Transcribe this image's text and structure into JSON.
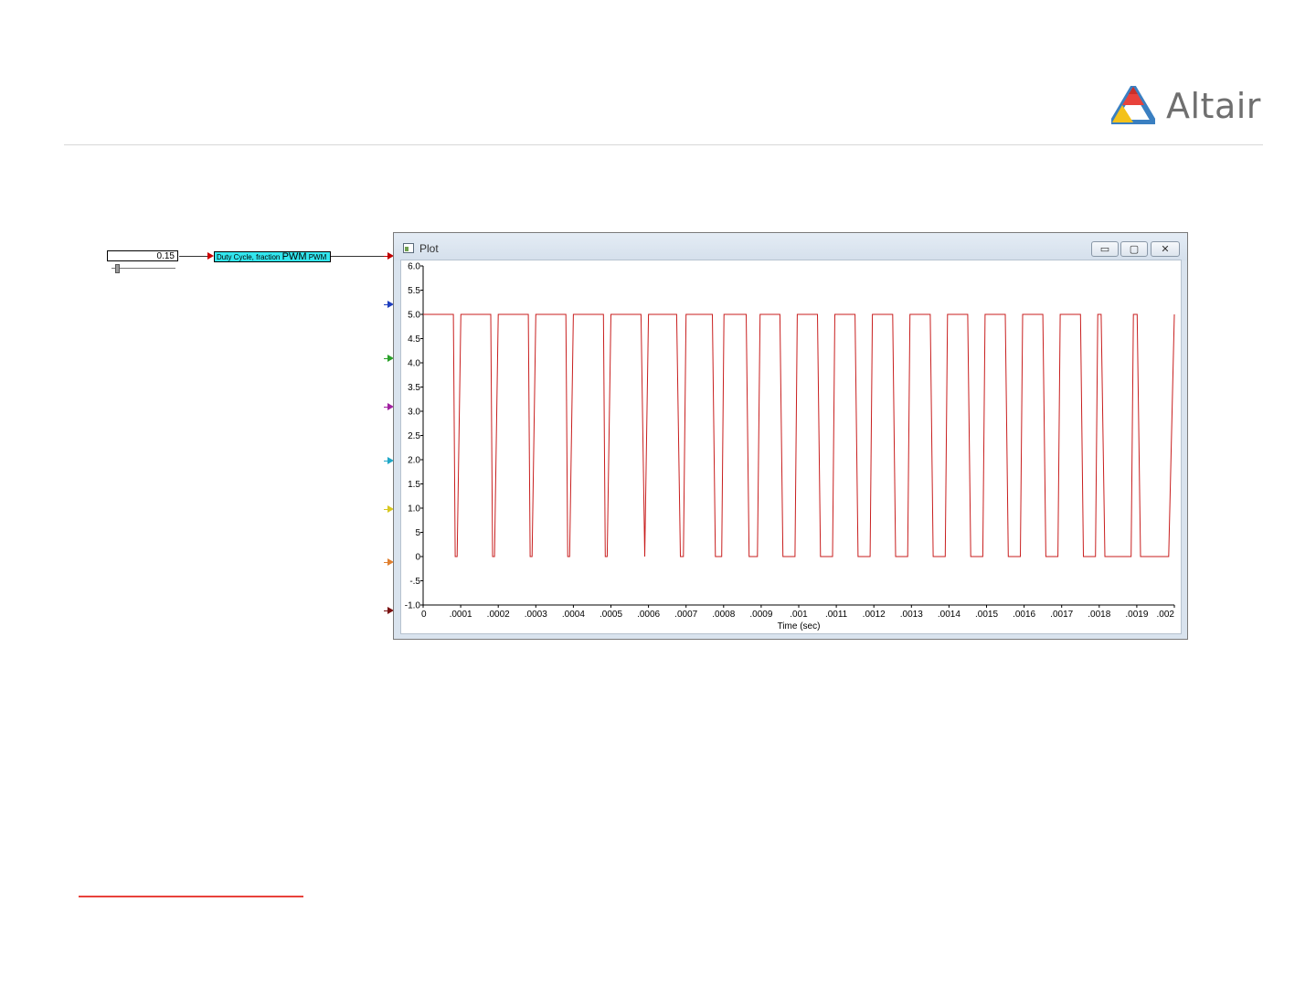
{
  "header": {
    "logo_text": "Altair",
    "logo_colors": {
      "red": "#e8423b",
      "blue": "#3a7fc1",
      "yellow": "#f3c21b",
      "gray": "#6f6f6f"
    }
  },
  "diagram": {
    "slider_value": "0.15",
    "pwm_block": {
      "label_small": "Duty Cycle, fraction",
      "label_big": "PWM",
      "label_out": "PWM"
    },
    "port_arrow_colors": [
      "#c00000",
      "#1f3fbf",
      "#2aa12a",
      "#a020a0",
      "#20a8c8",
      "#d8c820",
      "#e08030",
      "#7a1010"
    ]
  },
  "plot_window": {
    "title": "Plot",
    "buttons": {
      "minimize": "▭",
      "maximize": "▢",
      "close": "✕"
    }
  },
  "chart_data": {
    "type": "line",
    "xlabel": "Time (sec)",
    "ylabel": "",
    "xlim": [
      0,
      0.002
    ],
    "ylim": [
      -1.0,
      6.0
    ],
    "x_tick_labels": [
      "0",
      ".0001",
      ".0002",
      ".0003",
      ".0004",
      ".0005",
      ".0006",
      ".0007",
      ".0008",
      ".0009",
      ".001",
      ".0011",
      ".0012",
      ".0013",
      ".0014",
      ".0015",
      ".0016",
      ".0017",
      ".0018",
      ".0019",
      ".002"
    ],
    "y_tick_labels": [
      "6.0",
      "5.5",
      "5.0",
      "4.5",
      "4.0",
      "3.5",
      "3.0",
      "2.5",
      "2.0",
      "1.5",
      "1.0",
      "5",
      "0",
      "-.5",
      "-1.0"
    ],
    "y_tick_values": [
      6.0,
      5.5,
      5.0,
      4.5,
      4.0,
      3.5,
      3.0,
      2.5,
      2.0,
      1.5,
      1.0,
      0.5,
      0,
      -0.5,
      -1.0
    ],
    "series_color": "#c81e1e",
    "series": [
      {
        "x": [
          0,
          8.05e-05,
          8.55e-05,
          9.05e-05,
          0.0001005,
          0.00018,
          0.000185,
          0.00019,
          0.0002,
          0.00028,
          0.000285,
          0.00029,
          0.0003,
          0.00038,
          0.000385,
          0.00039,
          0.0004,
          0.00048,
          0.000485,
          0.00049,
          0.0005,
          0.00058,
          0.00059,
          0.0006,
          0.000675,
          0.000685,
          0.000693,
          0.0007,
          0.00077,
          0.000778,
          0.000795,
          0.000801,
          0.00086,
          0.000868,
          0.00089,
          0.000897,
          0.00095,
          0.000958,
          0.00099,
          0.000996,
          0.00105,
          0.001058,
          0.00109,
          0.001096,
          0.00115,
          0.001158,
          0.00119,
          0.001196,
          0.00125,
          0.001258,
          0.00129,
          0.001296,
          0.00135,
          0.001358,
          0.00139,
          0.001396,
          0.00145,
          0.001458,
          0.00149,
          0.001496,
          0.00155,
          0.001558,
          0.00159,
          0.001596,
          0.00165,
          0.001658,
          0.00169,
          0.001696,
          0.00175,
          0.001758,
          0.00179,
          0.001796,
          0.001805,
          0.001815,
          0.001885,
          0.001891,
          0.001901,
          0.00191,
          0.001985,
          0.002
        ],
        "y": [
          5,
          5,
          0,
          0,
          5,
          5,
          0,
          0,
          5,
          5,
          0,
          0,
          5,
          5,
          0,
          0,
          5,
          5,
          0,
          0,
          5,
          5,
          0,
          5,
          5,
          0,
          0,
          5,
          5,
          0,
          0,
          5,
          5,
          0,
          0,
          5,
          5,
          0,
          0,
          5,
          5,
          0,
          0,
          5,
          5,
          0,
          0,
          5,
          5,
          0,
          0,
          5,
          5,
          0,
          0,
          5,
          5,
          0,
          0,
          5,
          5,
          0,
          0,
          5,
          5,
          0,
          0,
          5,
          5,
          0,
          0,
          5,
          5,
          0,
          0,
          5,
          5,
          0,
          0,
          5
        ]
      }
    ]
  }
}
